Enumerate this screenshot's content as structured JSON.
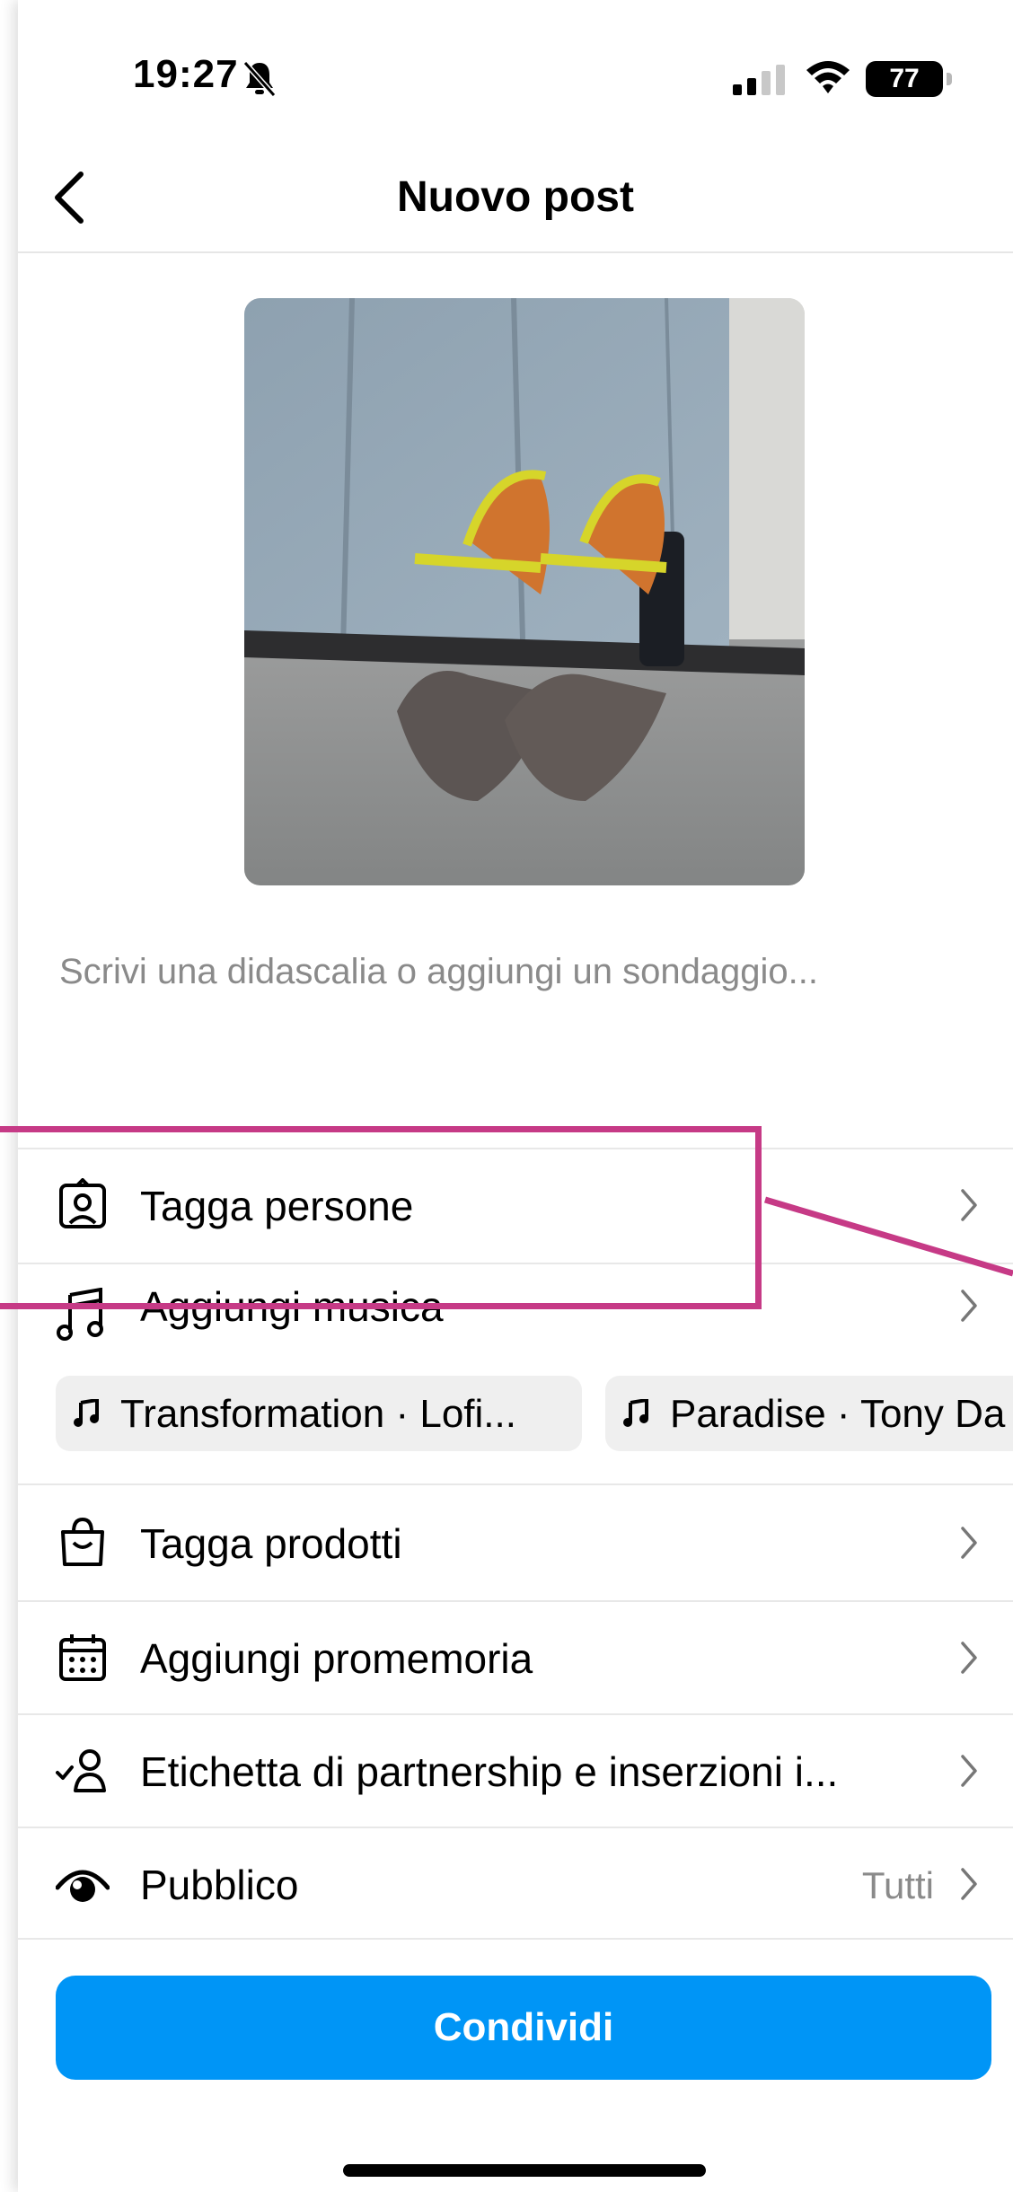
{
  "status_bar": {
    "time": "19:27",
    "battery": "77",
    "icons": [
      "bell-off-icon",
      "signal-icon",
      "wifi-icon",
      "battery-icon"
    ]
  },
  "nav": {
    "back_icon": "chevron-left-icon",
    "title": "Nuovo post"
  },
  "caption": {
    "placeholder": "Scrivi una didascalia o aggiungi un sondaggio..."
  },
  "options": {
    "tag_people": {
      "label": "Tagga persone",
      "icon": "user-tag-icon"
    },
    "add_music": {
      "label": "Aggiungi musica",
      "icon": "music-note-icon"
    },
    "tag_products": {
      "label": "Tagga prodotti",
      "icon": "shopping-bag-icon"
    },
    "add_reminder": {
      "label": "Aggiungi promemoria",
      "icon": "calendar-icon"
    },
    "partnership": {
      "label": "Etichetta di partnership e inserzioni i...",
      "icon": "user-check-icon"
    },
    "audience": {
      "label": "Pubblico",
      "value": "Tutti",
      "icon": "eye-icon"
    }
  },
  "music_suggestions": [
    {
      "label": "Transformation · Lofi..."
    },
    {
      "label": "Paradise · Tony Da"
    }
  ],
  "share_button": {
    "label": "Condividi"
  },
  "colors": {
    "accent": "#0095f6",
    "highlight": "#c63a86",
    "secondary_text": "#8a8a8a",
    "divider": "#e8e8e8"
  }
}
